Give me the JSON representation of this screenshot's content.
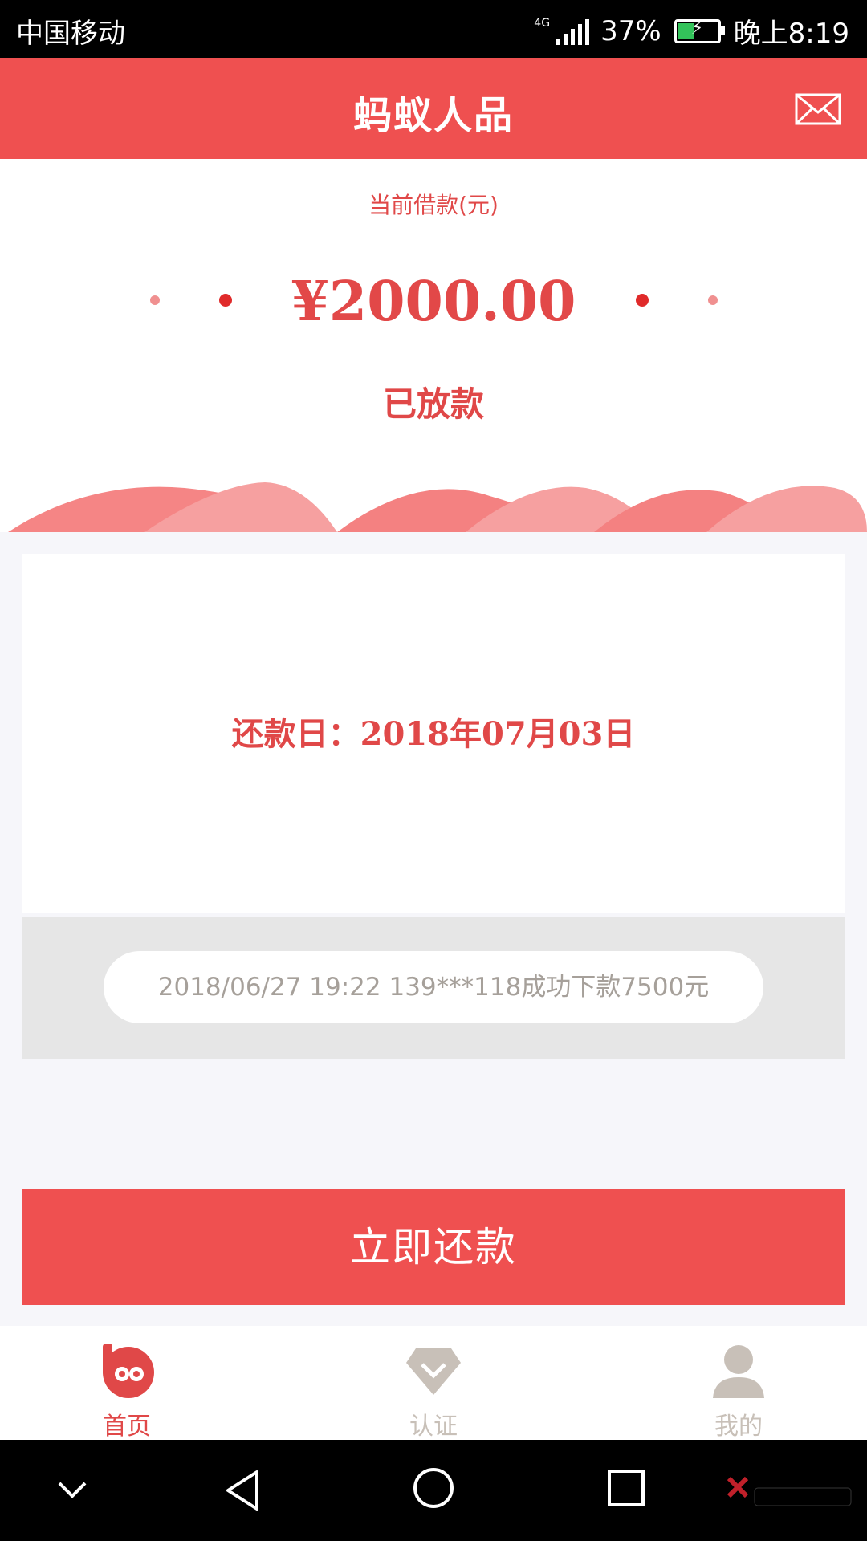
{
  "status_bar": {
    "carrier": "中国移动",
    "network": "4G",
    "battery": "37%",
    "time": "晚上8:19"
  },
  "header": {
    "title": "蚂蚁人品"
  },
  "loan": {
    "label": "当前借款(元)",
    "amount": "¥2000.00",
    "status": "已放款"
  },
  "repayment": {
    "due_date": "还款日：2018年07月03日"
  },
  "ticker": {
    "message": "2018/06/27 19:22 139***118成功下款7500元"
  },
  "actions": {
    "repay_label": "立即还款"
  },
  "tabs": [
    {
      "label": "首页",
      "active": true
    },
    {
      "label": "认证",
      "active": false
    },
    {
      "label": "我的",
      "active": false
    }
  ],
  "colors": {
    "brand": "#ef5050",
    "tab_active": "#e04848",
    "tab_inactive": "#c8c0b8"
  }
}
